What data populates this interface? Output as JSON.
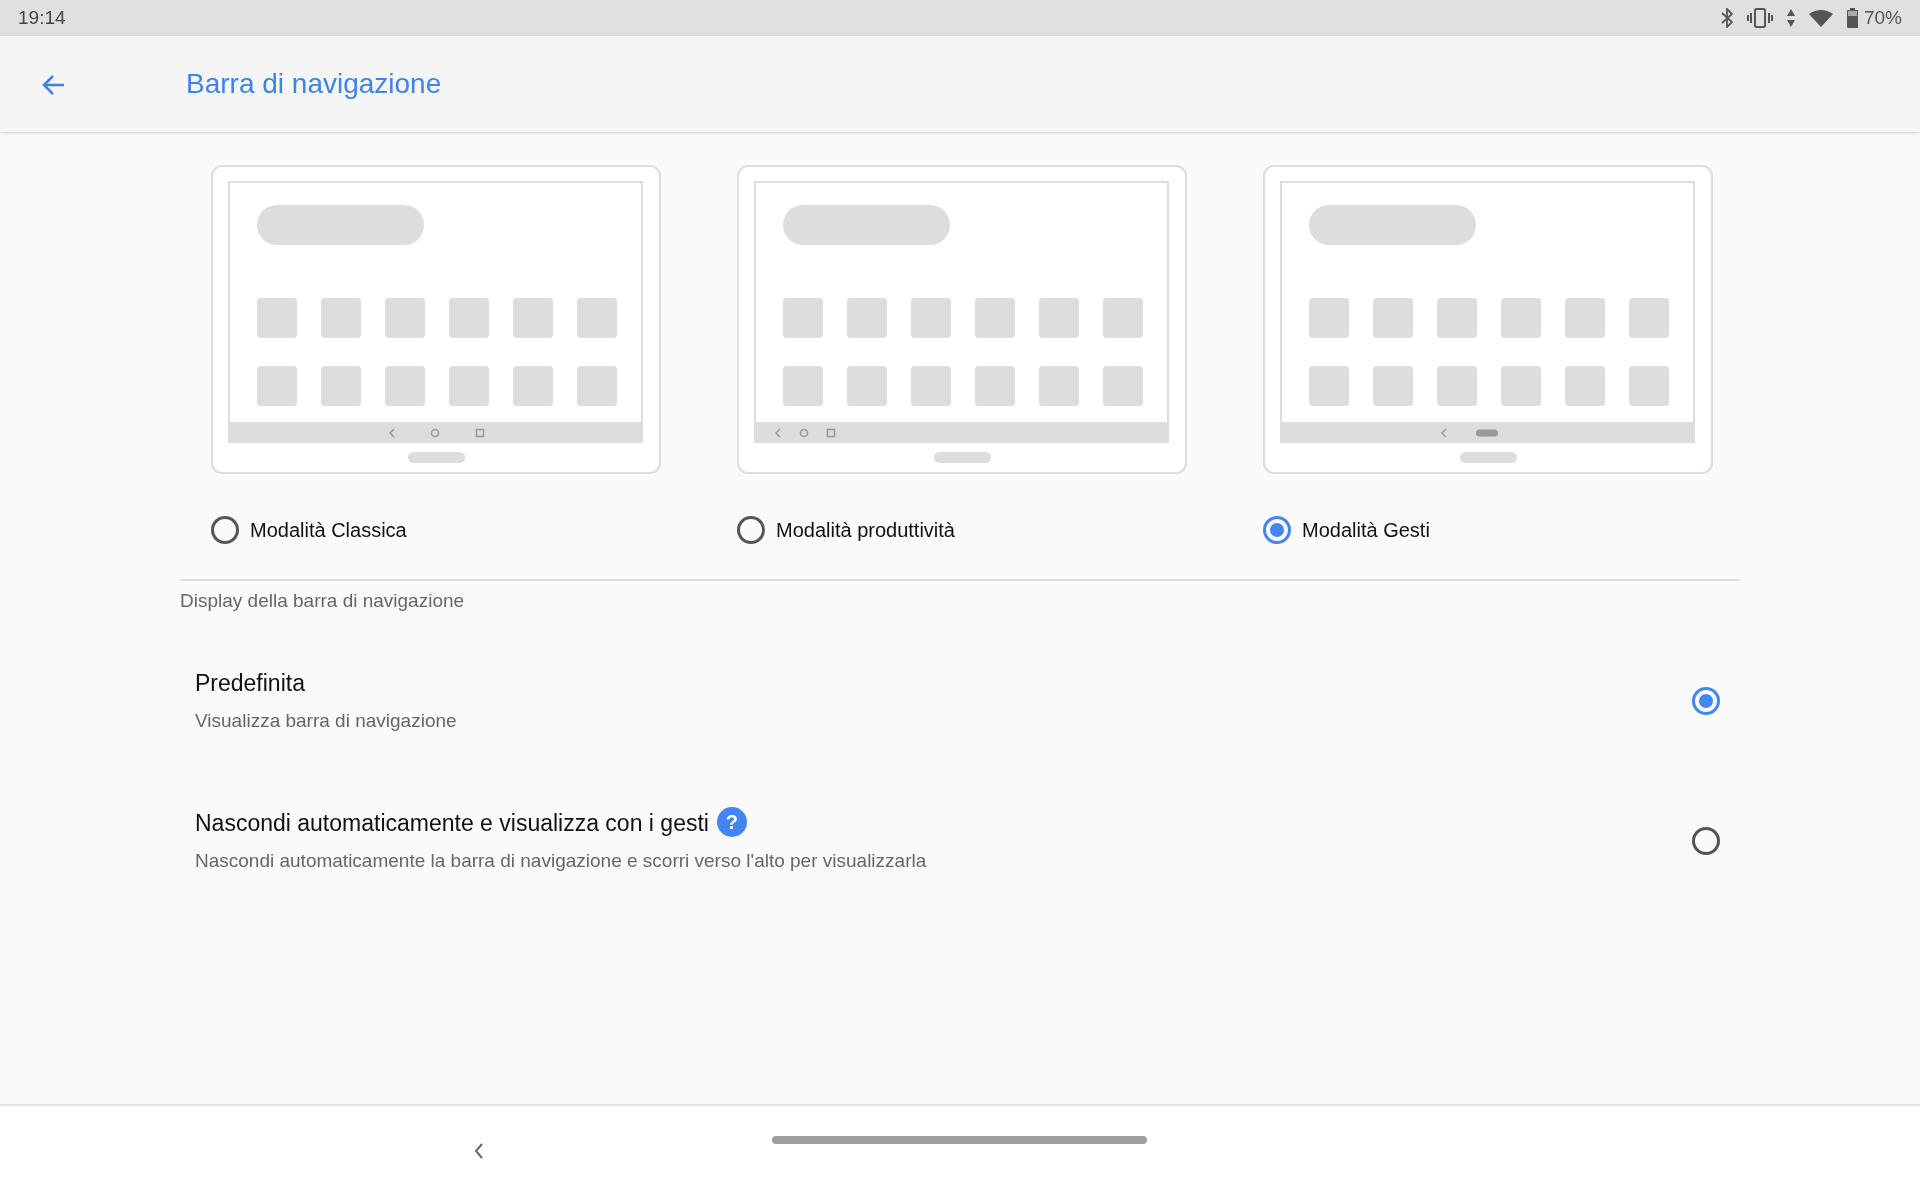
{
  "status_bar": {
    "time": "19:14",
    "battery": "70%"
  },
  "app_bar": {
    "title": "Barra di navigazione"
  },
  "nav_modes": [
    {
      "kind": "classic",
      "label": "Modalità Classica",
      "selected": false
    },
    {
      "kind": "productivity",
      "label": "Modalità produttività",
      "selected": false
    },
    {
      "kind": "gestures",
      "label": "Modalità Gesti",
      "selected": true
    }
  ],
  "section_header": "Display della barra di navigazione",
  "display_options": [
    {
      "title": "Predefinita",
      "subtitle": "Visualizza barra di navigazione",
      "selected": true
    },
    {
      "title": "Nascondi automaticamente e visualizza con i gesti",
      "help_icon": "?",
      "subtitle": "Nascondi automaticamente la barra di navigazione e scorri verso l'alto per visualizzarla",
      "selected": false
    }
  ]
}
